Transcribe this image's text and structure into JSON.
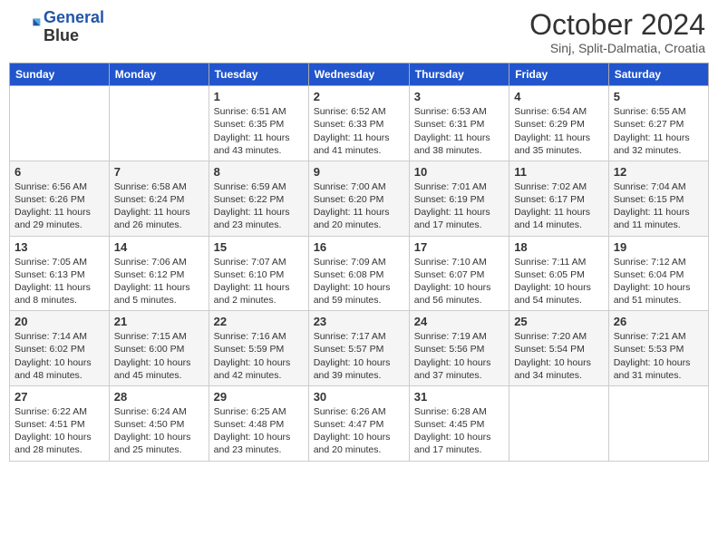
{
  "logo": {
    "line1": "General",
    "line2": "Blue"
  },
  "title": "October 2024",
  "subtitle": "Sinj, Split-Dalmatia, Croatia",
  "days_of_week": [
    "Sunday",
    "Monday",
    "Tuesday",
    "Wednesday",
    "Thursday",
    "Friday",
    "Saturday"
  ],
  "weeks": [
    [
      {
        "day": "",
        "info": ""
      },
      {
        "day": "",
        "info": ""
      },
      {
        "day": "1",
        "info": "Sunrise: 6:51 AM\nSunset: 6:35 PM\nDaylight: 11 hours and 43 minutes."
      },
      {
        "day": "2",
        "info": "Sunrise: 6:52 AM\nSunset: 6:33 PM\nDaylight: 11 hours and 41 minutes."
      },
      {
        "day": "3",
        "info": "Sunrise: 6:53 AM\nSunset: 6:31 PM\nDaylight: 11 hours and 38 minutes."
      },
      {
        "day": "4",
        "info": "Sunrise: 6:54 AM\nSunset: 6:29 PM\nDaylight: 11 hours and 35 minutes."
      },
      {
        "day": "5",
        "info": "Sunrise: 6:55 AM\nSunset: 6:27 PM\nDaylight: 11 hours and 32 minutes."
      }
    ],
    [
      {
        "day": "6",
        "info": "Sunrise: 6:56 AM\nSunset: 6:26 PM\nDaylight: 11 hours and 29 minutes."
      },
      {
        "day": "7",
        "info": "Sunrise: 6:58 AM\nSunset: 6:24 PM\nDaylight: 11 hours and 26 minutes."
      },
      {
        "day": "8",
        "info": "Sunrise: 6:59 AM\nSunset: 6:22 PM\nDaylight: 11 hours and 23 minutes."
      },
      {
        "day": "9",
        "info": "Sunrise: 7:00 AM\nSunset: 6:20 PM\nDaylight: 11 hours and 20 minutes."
      },
      {
        "day": "10",
        "info": "Sunrise: 7:01 AM\nSunset: 6:19 PM\nDaylight: 11 hours and 17 minutes."
      },
      {
        "day": "11",
        "info": "Sunrise: 7:02 AM\nSunset: 6:17 PM\nDaylight: 11 hours and 14 minutes."
      },
      {
        "day": "12",
        "info": "Sunrise: 7:04 AM\nSunset: 6:15 PM\nDaylight: 11 hours and 11 minutes."
      }
    ],
    [
      {
        "day": "13",
        "info": "Sunrise: 7:05 AM\nSunset: 6:13 PM\nDaylight: 11 hours and 8 minutes."
      },
      {
        "day": "14",
        "info": "Sunrise: 7:06 AM\nSunset: 6:12 PM\nDaylight: 11 hours and 5 minutes."
      },
      {
        "day": "15",
        "info": "Sunrise: 7:07 AM\nSunset: 6:10 PM\nDaylight: 11 hours and 2 minutes."
      },
      {
        "day": "16",
        "info": "Sunrise: 7:09 AM\nSunset: 6:08 PM\nDaylight: 10 hours and 59 minutes."
      },
      {
        "day": "17",
        "info": "Sunrise: 7:10 AM\nSunset: 6:07 PM\nDaylight: 10 hours and 56 minutes."
      },
      {
        "day": "18",
        "info": "Sunrise: 7:11 AM\nSunset: 6:05 PM\nDaylight: 10 hours and 54 minutes."
      },
      {
        "day": "19",
        "info": "Sunrise: 7:12 AM\nSunset: 6:04 PM\nDaylight: 10 hours and 51 minutes."
      }
    ],
    [
      {
        "day": "20",
        "info": "Sunrise: 7:14 AM\nSunset: 6:02 PM\nDaylight: 10 hours and 48 minutes."
      },
      {
        "day": "21",
        "info": "Sunrise: 7:15 AM\nSunset: 6:00 PM\nDaylight: 10 hours and 45 minutes."
      },
      {
        "day": "22",
        "info": "Sunrise: 7:16 AM\nSunset: 5:59 PM\nDaylight: 10 hours and 42 minutes."
      },
      {
        "day": "23",
        "info": "Sunrise: 7:17 AM\nSunset: 5:57 PM\nDaylight: 10 hours and 39 minutes."
      },
      {
        "day": "24",
        "info": "Sunrise: 7:19 AM\nSunset: 5:56 PM\nDaylight: 10 hours and 37 minutes."
      },
      {
        "day": "25",
        "info": "Sunrise: 7:20 AM\nSunset: 5:54 PM\nDaylight: 10 hours and 34 minutes."
      },
      {
        "day": "26",
        "info": "Sunrise: 7:21 AM\nSunset: 5:53 PM\nDaylight: 10 hours and 31 minutes."
      }
    ],
    [
      {
        "day": "27",
        "info": "Sunrise: 6:22 AM\nSunset: 4:51 PM\nDaylight: 10 hours and 28 minutes."
      },
      {
        "day": "28",
        "info": "Sunrise: 6:24 AM\nSunset: 4:50 PM\nDaylight: 10 hours and 25 minutes."
      },
      {
        "day": "29",
        "info": "Sunrise: 6:25 AM\nSunset: 4:48 PM\nDaylight: 10 hours and 23 minutes."
      },
      {
        "day": "30",
        "info": "Sunrise: 6:26 AM\nSunset: 4:47 PM\nDaylight: 10 hours and 20 minutes."
      },
      {
        "day": "31",
        "info": "Sunrise: 6:28 AM\nSunset: 4:45 PM\nDaylight: 10 hours and 17 minutes."
      },
      {
        "day": "",
        "info": ""
      },
      {
        "day": "",
        "info": ""
      }
    ]
  ]
}
